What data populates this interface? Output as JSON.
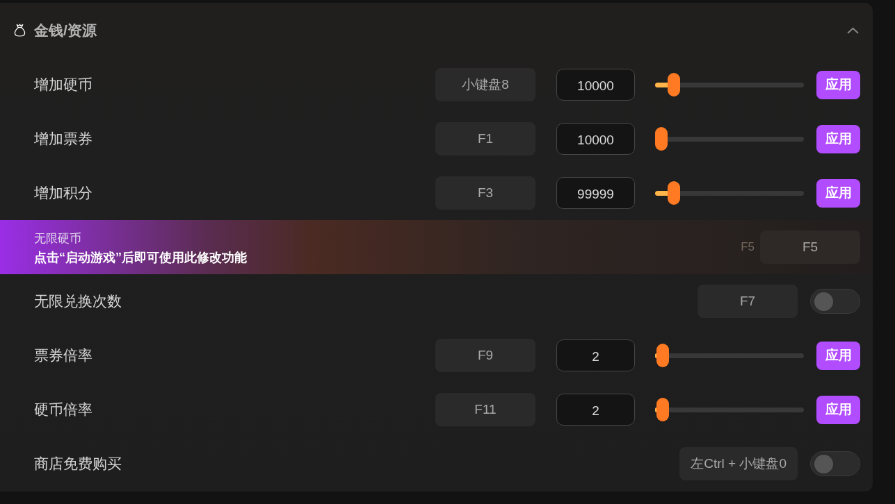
{
  "section": {
    "title": "金钱/资源",
    "expanded": true,
    "rows": [
      {
        "kind": "slider",
        "label": "增加硬币",
        "hotkey": "小键盘8",
        "value": "10000",
        "level": 0.09,
        "apply": "应用"
      },
      {
        "kind": "slider",
        "label": "增加票券",
        "hotkey": "F1",
        "value": "10000",
        "level": 0,
        "apply": "应用"
      },
      {
        "kind": "slider",
        "label": "增加积分",
        "hotkey": "F3",
        "value": "99999",
        "level": 0.09,
        "apply": "应用"
      },
      {
        "kind": "locked",
        "label": "无限硬币",
        "notice": "点击“启动游戏”后即可使用此修改功能",
        "hint_key": "F5",
        "hotkey": "F5"
      },
      {
        "kind": "toggle",
        "label": "无限兑换次数",
        "hotkey": "F7",
        "on": false
      },
      {
        "kind": "slider",
        "label": "票券倍率",
        "hotkey": "F9",
        "value": "2",
        "level": 0.01,
        "apply": "应用"
      },
      {
        "kind": "slider",
        "label": "硬币倍率",
        "hotkey": "F11",
        "value": "2",
        "level": 0.01,
        "apply": "应用"
      },
      {
        "kind": "toggle",
        "label": "商店免费购买",
        "hotkey": "左Ctrl + 小键盘0",
        "on": false
      }
    ]
  }
}
